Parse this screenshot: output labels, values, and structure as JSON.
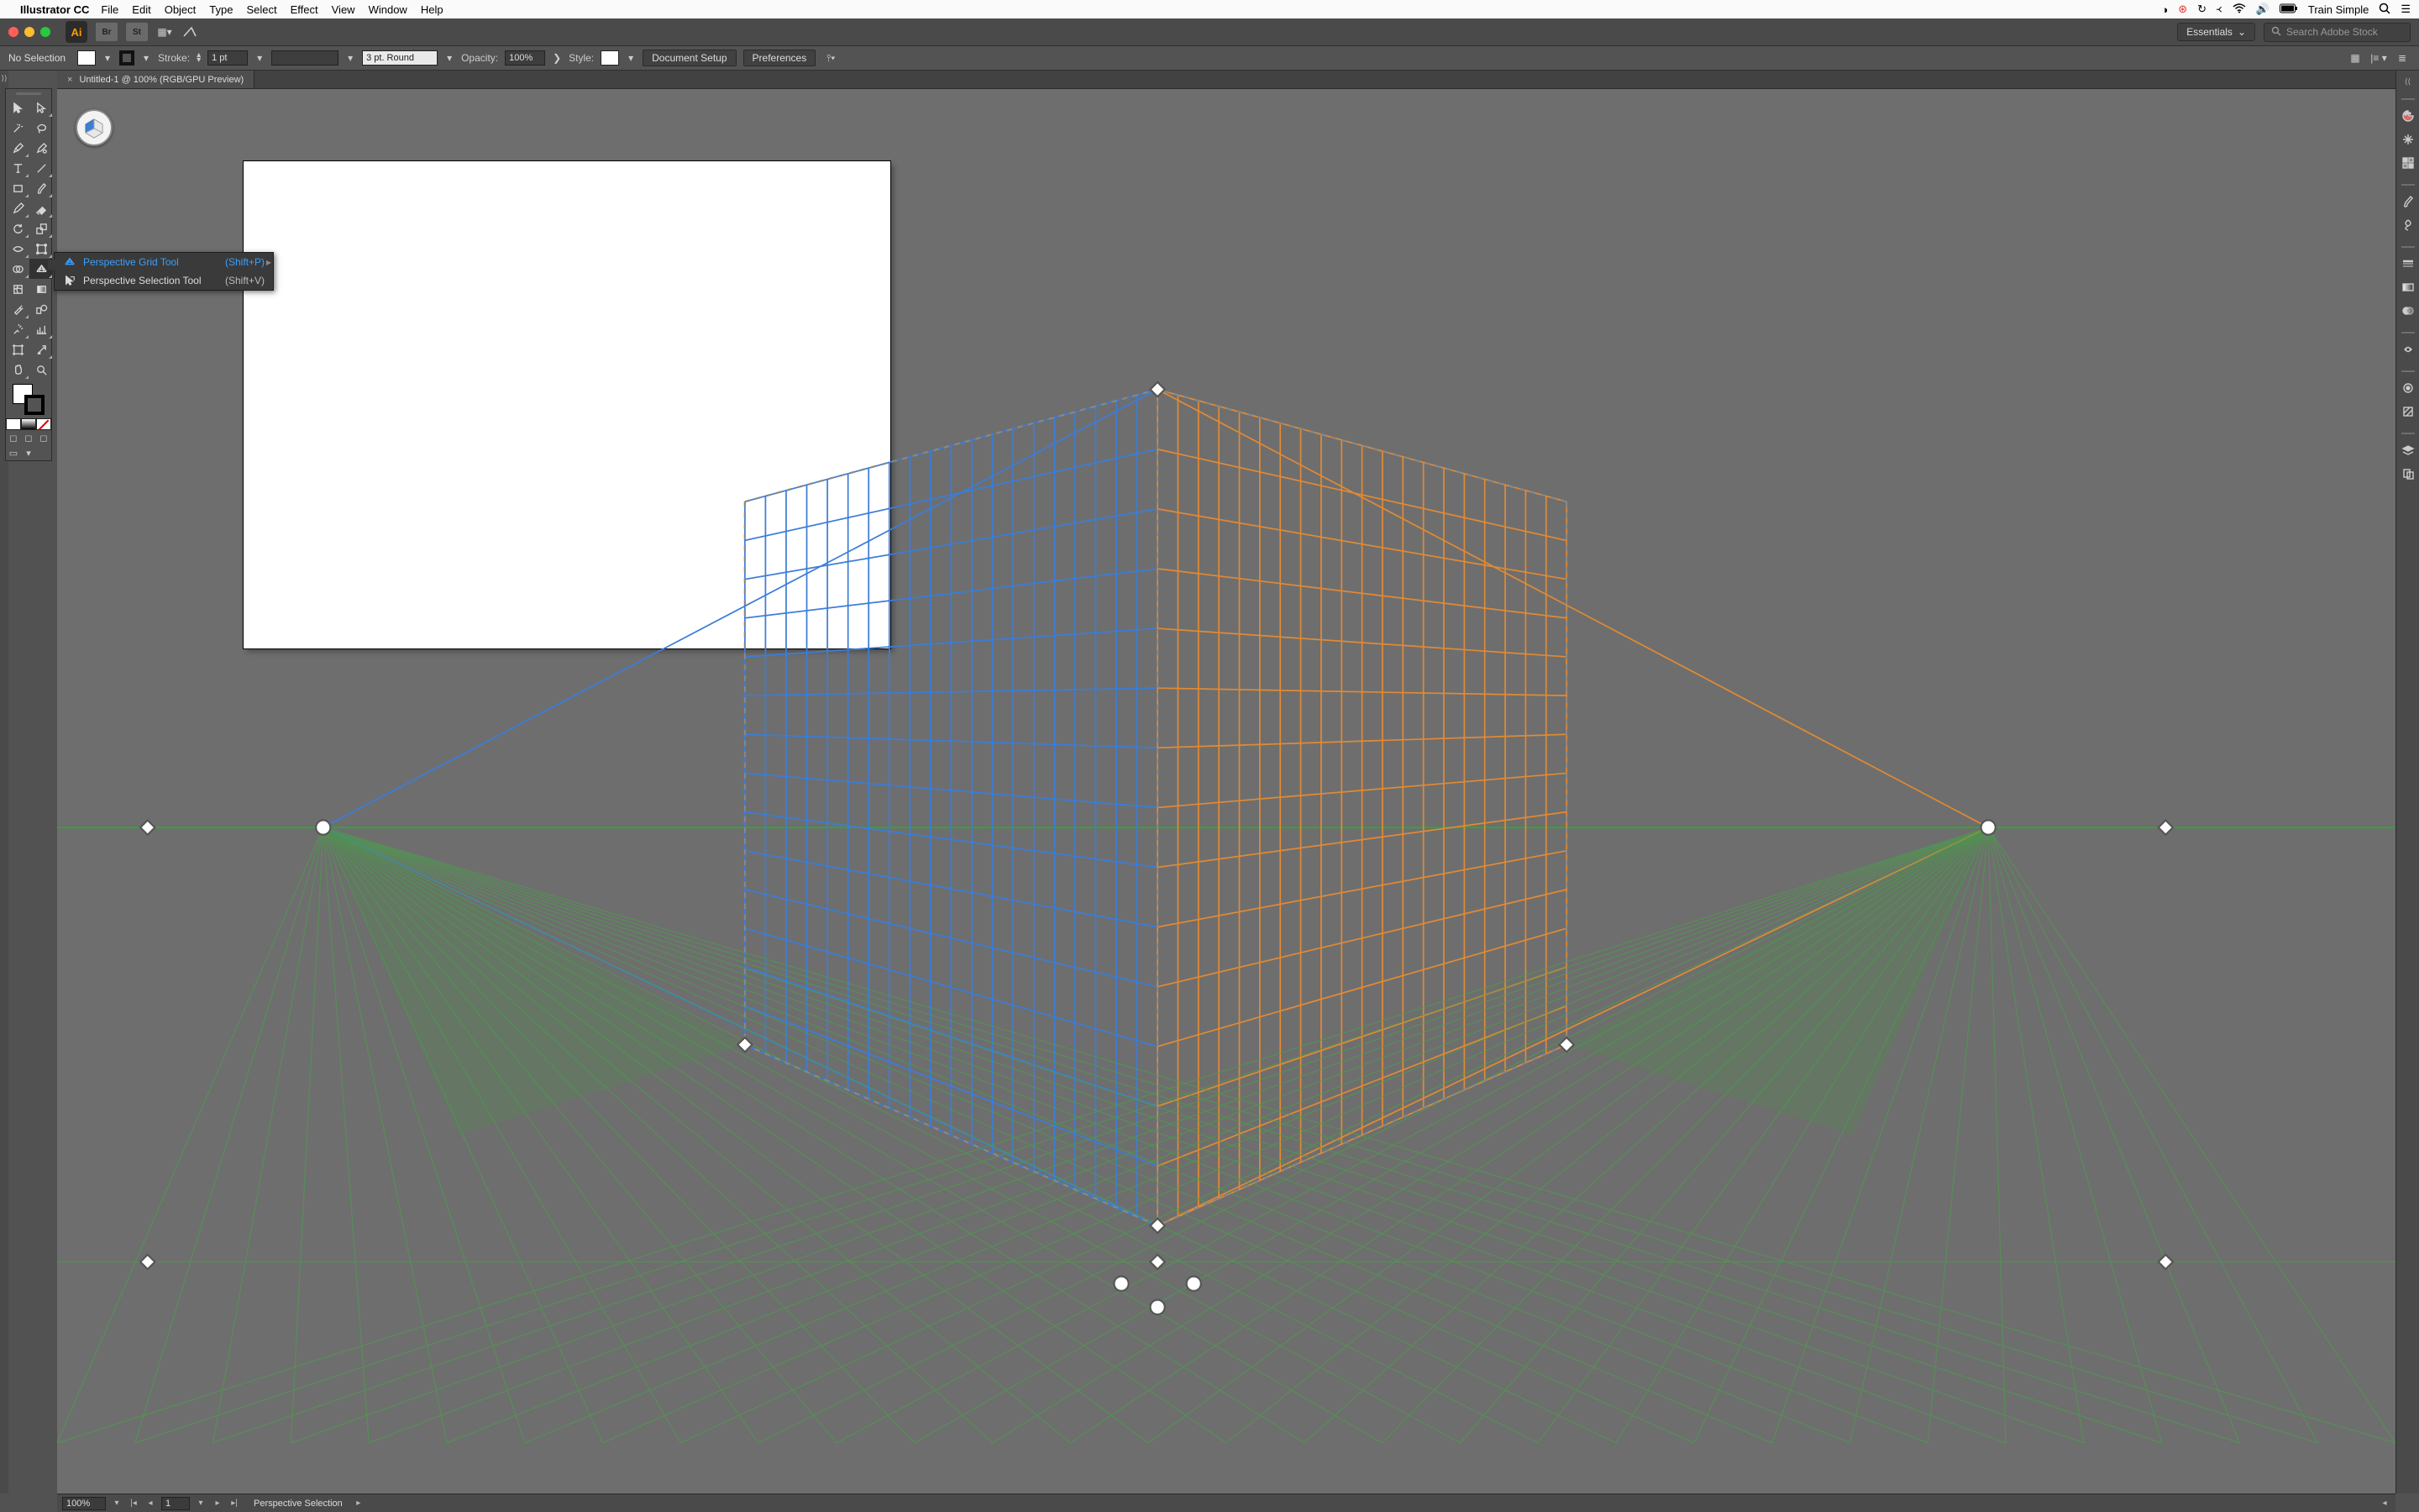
{
  "mac": {
    "app_name": "Illustrator CC",
    "menus": [
      "File",
      "Edit",
      "Object",
      "Type",
      "Select",
      "Effect",
      "View",
      "Window",
      "Help"
    ],
    "account": "Train Simple"
  },
  "app_bar": {
    "workspace": "Essentials",
    "stock_placeholder": "Search Adobe Stock"
  },
  "control": {
    "selection_label": "No Selection",
    "stroke_label": "Stroke:",
    "stroke_value": "1 pt",
    "brush_preset": "3 pt. Round",
    "opacity_label": "Opacity:",
    "opacity_value": "100%",
    "style_label": "Style:",
    "document_setup": "Document Setup",
    "preferences": "Preferences"
  },
  "doc_tab": {
    "title": "Untitled-1 @ 100% (RGB/GPU Preview)"
  },
  "flyout": {
    "items": [
      {
        "label": "Perspective Grid Tool",
        "shortcut": "(Shift+P)",
        "selected": true
      },
      {
        "label": "Perspective Selection Tool",
        "shortcut": "(Shift+V)",
        "selected": false
      }
    ]
  },
  "status": {
    "zoom": "100%",
    "artboard": "1",
    "tool": "Perspective Selection"
  }
}
